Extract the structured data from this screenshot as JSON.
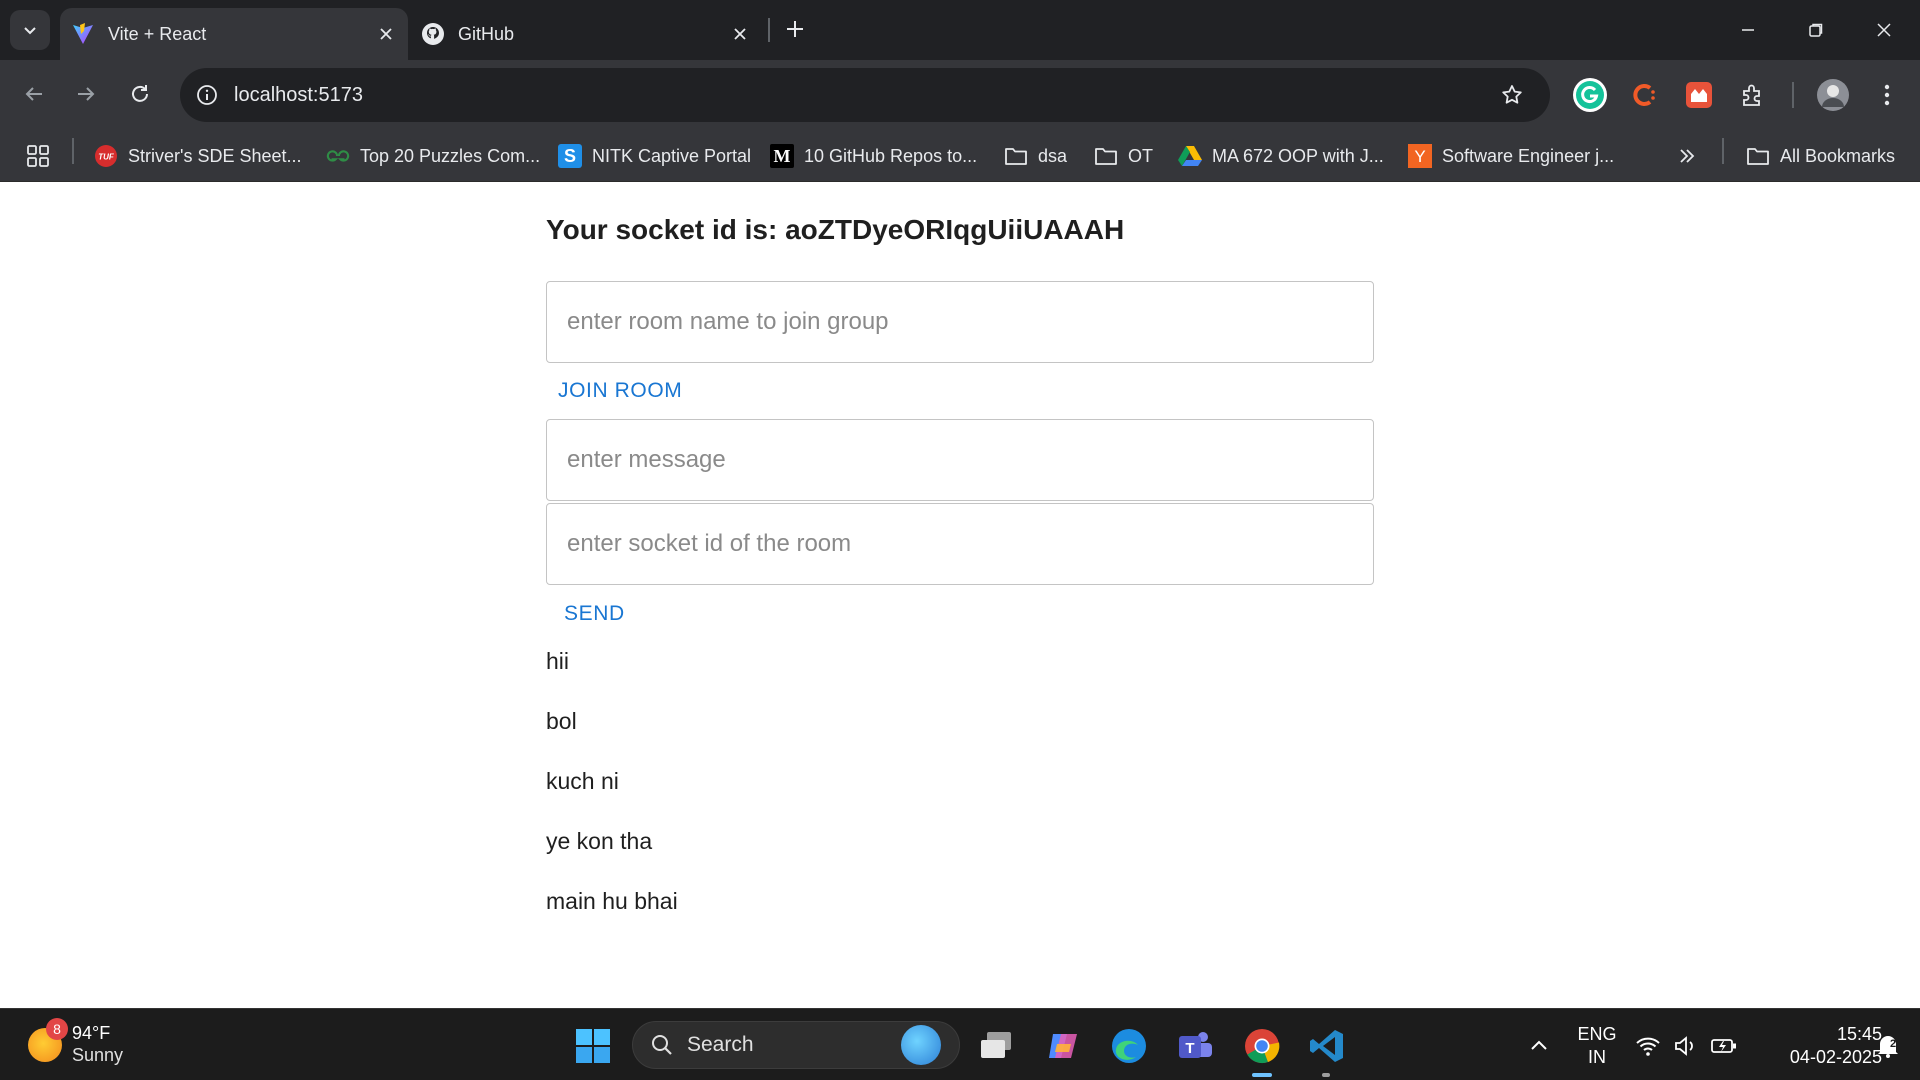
{
  "browser": {
    "tabs": [
      {
        "title": "Vite + React",
        "favicon": "vite-icon",
        "active": true
      },
      {
        "title": "GitHub",
        "favicon": "github-icon",
        "active": false
      }
    ],
    "url": "localhost:5173",
    "bookmarks": [
      {
        "label": "Striver's SDE Sheet...",
        "icon": "tuf-icon",
        "badge": "TUF"
      },
      {
        "label": "Top 20 Puzzles Com...",
        "icon": "gfg-icon",
        "badge": "ᵹG"
      },
      {
        "label": "NITK Captive Portal",
        "icon": "s-icon",
        "badge": "S"
      },
      {
        "label": "10 GitHub Repos to...",
        "icon": "medium-icon",
        "badge": "M"
      },
      {
        "label": "dsa",
        "icon": "folder-icon"
      },
      {
        "label": "OT",
        "icon": "folder-icon"
      },
      {
        "label": "MA 672 OOP with J...",
        "icon": "drive-icon"
      },
      {
        "label": "Software Engineer j...",
        "icon": "ycombinator-icon",
        "badge": "Y"
      }
    ],
    "all_bookmarks_label": "All Bookmarks"
  },
  "app": {
    "heading": "Your socket id is: aoZTDyeORIqgUiiUAAAH",
    "room_input_placeholder": "enter room name to join group",
    "join_label": "JOIN ROOM",
    "message_input_placeholder": "enter message",
    "socket_input_placeholder": "enter socket id of the room",
    "send_label": "SEND",
    "messages": [
      "hii",
      "bol",
      "kuch ni",
      "ye kon tha",
      "main hu bhai"
    ]
  },
  "taskbar": {
    "weather_badge": "8",
    "temperature": "94°F",
    "condition": "Sunny",
    "search_label": "Search",
    "language": "ENG",
    "region": "IN",
    "time": "15:45",
    "date": "04-02-2025",
    "notification_badge": "2"
  },
  "colors": {
    "accent": "#1976d2",
    "chrome_dark": "#202124",
    "chrome_toolbar": "#35363a",
    "taskbar": "#1c1c1c"
  }
}
